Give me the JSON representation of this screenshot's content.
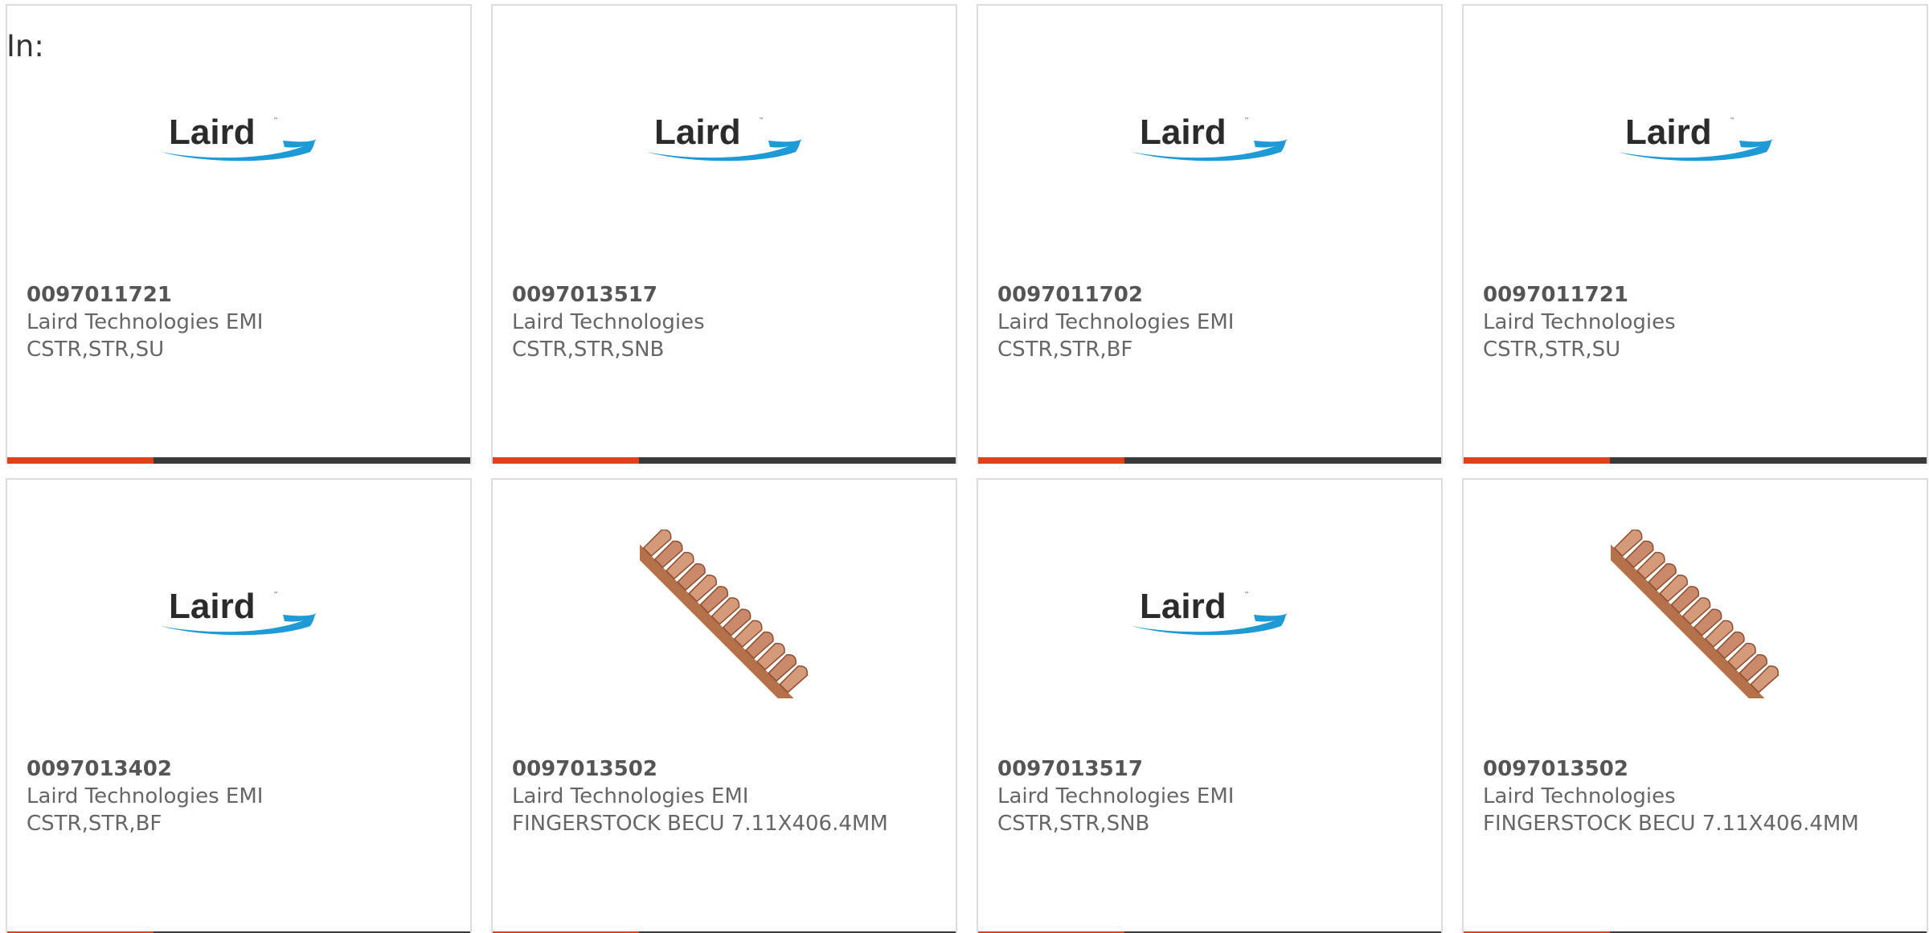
{
  "filter": {
    "label": "In:"
  },
  "accent_color": "#e0401b",
  "bar_color": "#3a3a3a",
  "products": [
    {
      "part_number": "0097011721",
      "manufacturer": "Laird Technologies EMI",
      "description": "CSTR,STR,SU",
      "image": "laird-logo"
    },
    {
      "part_number": "0097013517",
      "manufacturer": "Laird Technologies",
      "description": "CSTR,STR,SNB",
      "image": "laird-logo"
    },
    {
      "part_number": "0097011702",
      "manufacturer": "Laird Technologies EMI",
      "description": "CSTR,STR,BF",
      "image": "laird-logo"
    },
    {
      "part_number": "0097011721",
      "manufacturer": "Laird Technologies",
      "description": "CSTR,STR,SU",
      "image": "laird-logo"
    },
    {
      "part_number": "0097013402",
      "manufacturer": "Laird Technologies EMI",
      "description": "CSTR,STR,BF",
      "image": "laird-logo"
    },
    {
      "part_number": "0097013502",
      "manufacturer": "Laird Technologies EMI",
      "description": "FINGERSTOCK BECU 7.11X406.4MM",
      "image": "fingerstock-photo"
    },
    {
      "part_number": "0097013517",
      "manufacturer": "Laird Technologies EMI",
      "description": "CSTR,STR,SNB",
      "image": "laird-logo"
    },
    {
      "part_number": "0097013502",
      "manufacturer": "Laird Technologies",
      "description": "FINGERSTOCK BECU 7.11X406.4MM",
      "image": "fingerstock-photo"
    }
  ]
}
